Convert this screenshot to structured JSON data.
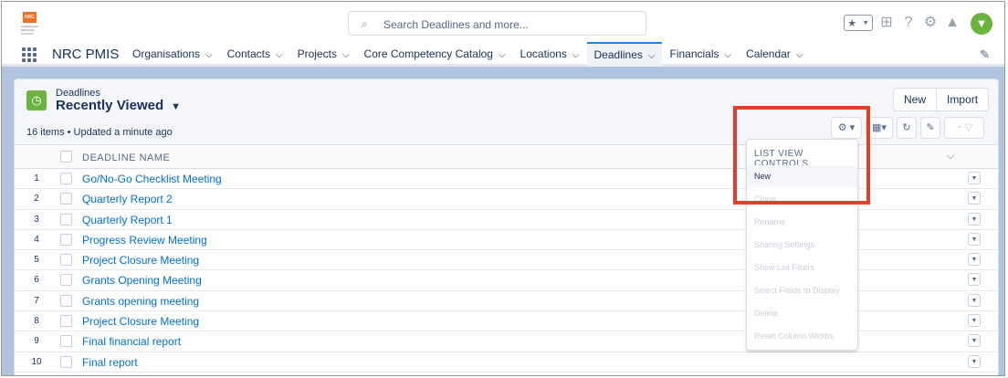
{
  "header": {
    "logo_text": "NRC",
    "logo_subtext": "NORWEGIAN REFUGEE COUNCIL",
    "search_placeholder": "Search Deadlines and more...",
    "icons": [
      "star-icon",
      "plus-icon",
      "help-icon",
      "gear-icon",
      "bell-icon",
      "avatar"
    ]
  },
  "nav": {
    "app_name": "NRC PMIS",
    "tabs": [
      {
        "label": "Organisations",
        "active": false
      },
      {
        "label": "Contacts",
        "active": false
      },
      {
        "label": "Projects",
        "active": false
      },
      {
        "label": "Core Competency Catalog",
        "active": false
      },
      {
        "label": "Locations",
        "active": false
      },
      {
        "label": "Deadlines",
        "active": true
      },
      {
        "label": "Financials",
        "active": false
      },
      {
        "label": "Calendar",
        "active": false
      }
    ]
  },
  "list": {
    "object_label": "Deadlines",
    "view_name": "Recently Viewed",
    "meta": "16 items • Updated a minute ago",
    "buttons": {
      "new": "New",
      "import": "Import"
    },
    "column_header": "DEADLINE NAME",
    "rows": [
      {
        "num": "1",
        "name": "Go/No-Go Checklist Meeting"
      },
      {
        "num": "2",
        "name": "Quarterly Report 2"
      },
      {
        "num": "3",
        "name": "Quarterly Report 1"
      },
      {
        "num": "4",
        "name": "Progress Review Meeting"
      },
      {
        "num": "5",
        "name": "Project Closure Meeting"
      },
      {
        "num": "6",
        "name": "Grants Opening Meeting"
      },
      {
        "num": "7",
        "name": "Grants opening meeting"
      },
      {
        "num": "8",
        "name": "Project Closure Meeting"
      },
      {
        "num": "9",
        "name": "Final financial report"
      },
      {
        "num": "10",
        "name": "Final report"
      }
    ]
  },
  "dropdown": {
    "title": "LIST VIEW CONTROLS",
    "items": [
      {
        "label": "New",
        "enabled": true
      },
      {
        "label": "Clone",
        "enabled": false
      },
      {
        "label": "Rename",
        "enabled": false
      },
      {
        "label": "Sharing Settings",
        "enabled": false
      },
      {
        "label": "Show List Filters",
        "enabled": false
      },
      {
        "label": "Select Fields to Display",
        "enabled": false
      },
      {
        "label": "Delete",
        "enabled": false
      },
      {
        "label": "Reset Column Widths",
        "enabled": false
      }
    ]
  },
  "colors": {
    "highlight": "#e0402b",
    "accent": "#1589ee",
    "link": "#0070d2",
    "object_icon": "#6bb23e",
    "logo": "#f36f21"
  }
}
